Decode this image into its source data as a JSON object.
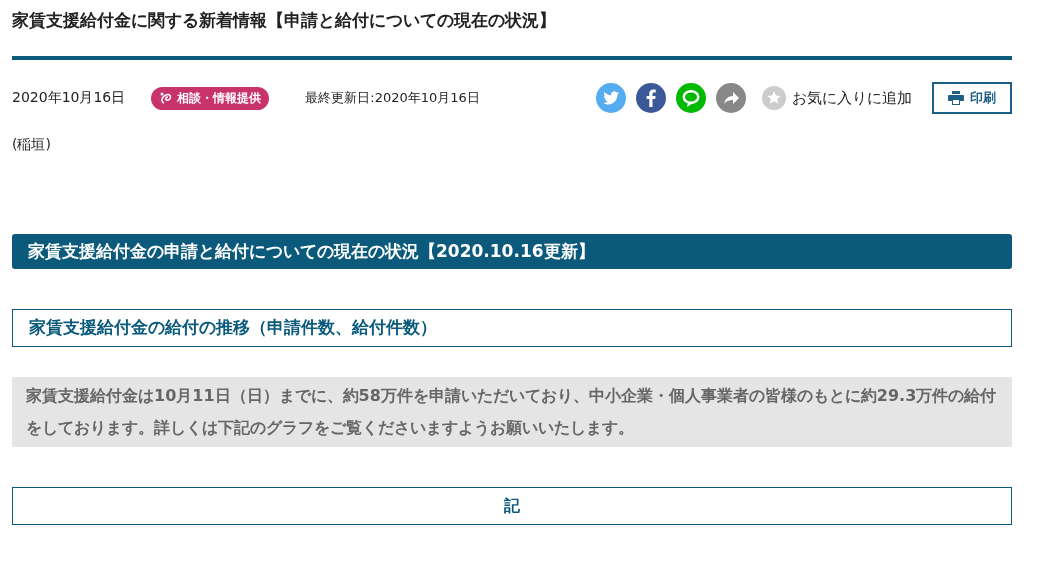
{
  "title": "家賃支援給付金に関する新着情報【申請と給付についての現在の状況】",
  "meta": {
    "date": "2020年10月16日",
    "tag": "相談・情報提供",
    "updated": "最終更新日:2020年10月16日"
  },
  "actions": {
    "favorite": "お気に入りに追加",
    "print": "印刷"
  },
  "author": "(稲垣)",
  "section_heading": "家賃支援給付金の申請と給付についての現在の状況【2020.10.16更新】",
  "subheading": "家賃支援給付金の給付の推移（申請件数、給付件数）",
  "notice": "家賃支援給付金は10月11日（日）までに、約58万件を申請いただいており、中小企業・個人事業者の皆様のもとに約29.3万件の給付をしております。詳しくは下記のグラフをご覧くださいますようお願いいたします。",
  "note_heading": "記"
}
